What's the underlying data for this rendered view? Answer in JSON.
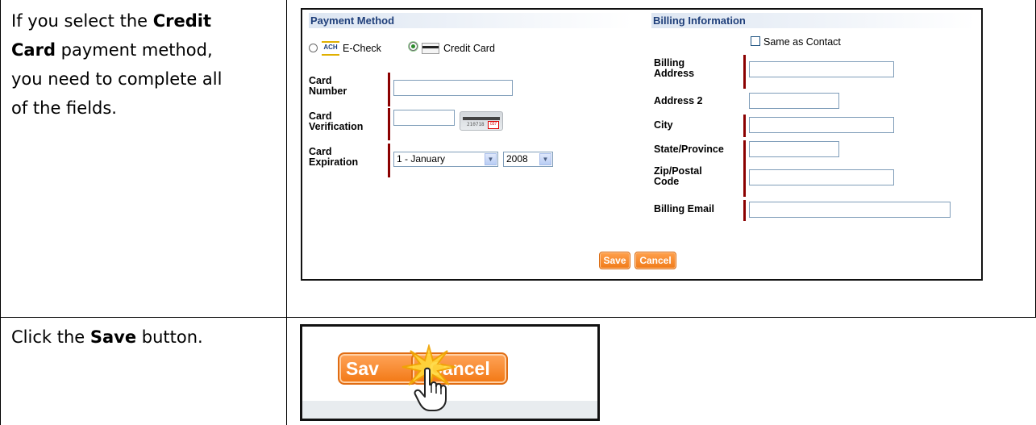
{
  "instructions": {
    "row1": {
      "text_a": "If you select the ",
      "bold_a": "Credit",
      "bold_b": "Card",
      "text_b": " payment method,",
      "text_c": "you need to complete all",
      "text_d": "of the fields."
    },
    "row2": {
      "text_a": "Click the ",
      "bold_a": "Save",
      "text_b": " button."
    }
  },
  "payment": {
    "section_title": "Payment Method",
    "options": [
      {
        "label": "E-Check",
        "icon": "ach-icon",
        "icon_text": "ACH",
        "selected": false
      },
      {
        "label": "Credit Card",
        "icon": "credit-card-icon",
        "selected": true
      }
    ],
    "card_number_label_1": "Card",
    "card_number_label_2": "Number",
    "card_number_value": "",
    "card_verification_label_1": "Card",
    "card_verification_label_2": "Verification",
    "card_verification_value": "",
    "cvv_image_number": "210718",
    "cvv_image_code": "037",
    "card_expiration_label_1": "Card",
    "card_expiration_label_2": "Expiration",
    "expiration_month": "1 - January",
    "expiration_year": "2008"
  },
  "billing": {
    "section_title": "Billing Information",
    "same_as_contact_label": "Same as Contact",
    "same_as_contact_checked": false,
    "address_label_1": "Billing",
    "address_label_2": "Address",
    "address2_label": "Address 2",
    "city_label": "City",
    "state_label": "State/Province",
    "zip_label_1": "Zip/Postal",
    "zip_label_2": "Code",
    "email_label": "Billing Email"
  },
  "actions": {
    "save_label": "Save",
    "cancel_label": "Cancel"
  },
  "zoom": {
    "save_label": "Sav",
    "cancel_label": "Cancel"
  },
  "colors": {
    "button_orange": "#f07a18",
    "required_marker": "#8b0000",
    "section_title": "#1f3f7a"
  }
}
